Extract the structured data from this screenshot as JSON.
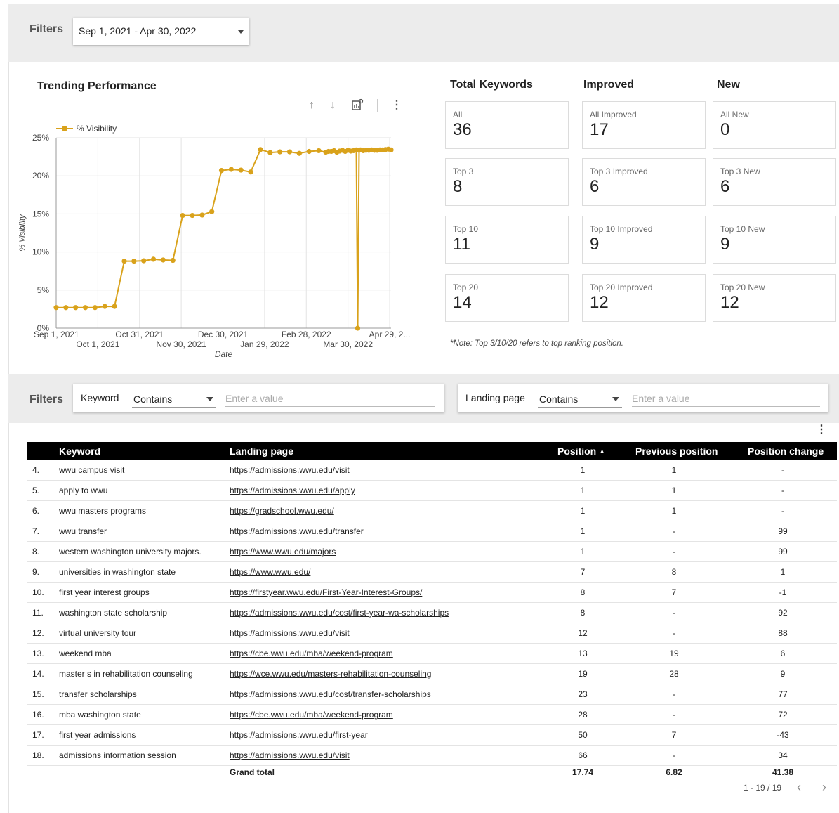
{
  "top_filter": {
    "label": "Filters",
    "date_range": "Sep 1, 2021 - Apr 30, 2022"
  },
  "chart": {
    "title": "Trending Performance",
    "icons": [
      "arrow-up-icon",
      "arrow-down-icon",
      "chart-options-icon",
      "more-vert-icon"
    ]
  },
  "chart_data": {
    "type": "line",
    "title": "Trending Performance",
    "xlabel": "Date",
    "ylabel": "% Visibility",
    "legend": "top-left",
    "series_name": "% Visibility",
    "color": "#d9a21b",
    "grid": true,
    "ylim": [
      0,
      25
    ],
    "xlim": [
      "2021-09-01",
      "2022-04-30"
    ],
    "y_ticks": [
      "0%",
      "5%",
      "10%",
      "15%",
      "20%",
      "25%"
    ],
    "x_ticks_upper": [
      "Sep 1, 2021",
      "Oct 31, 2021",
      "Dec 30, 2021",
      "Feb 28, 2022",
      "Apr 29, 2..."
    ],
    "x_ticks_lower": [
      "Oct 1, 2021",
      "Nov 30, 2021",
      "Jan 29, 2022",
      "Mar 30, 2022"
    ],
    "x": [
      "2021-09-01",
      "2021-09-08",
      "2021-09-15",
      "2021-09-22",
      "2021-09-29",
      "2021-10-06",
      "2021-10-13",
      "2021-10-20",
      "2021-10-27",
      "2021-11-03",
      "2021-11-10",
      "2021-11-17",
      "2021-11-24",
      "2021-12-01",
      "2021-12-08",
      "2021-12-15",
      "2021-12-22",
      "2021-12-29",
      "2022-01-05",
      "2022-01-12",
      "2022-01-19",
      "2022-01-26",
      "2022-02-02",
      "2022-02-09",
      "2022-02-16",
      "2022-02-23",
      "2022-03-02",
      "2022-03-09",
      "2022-03-14",
      "2022-03-16",
      "2022-03-18",
      "2022-03-20",
      "2022-03-22",
      "2022-03-24",
      "2022-03-26",
      "2022-03-28",
      "2022-03-30",
      "2022-04-01",
      "2022-04-03",
      "2022-04-05",
      "2022-04-06",
      "2022-04-07",
      "2022-04-08",
      "2022-04-10",
      "2022-04-12",
      "2022-04-14",
      "2022-04-16",
      "2022-04-18",
      "2022-04-20",
      "2022-04-22",
      "2022-04-24",
      "2022-04-26",
      "2022-04-28",
      "2022-04-30"
    ],
    "y": [
      2.7,
      2.7,
      2.7,
      2.7,
      2.7,
      2.85,
      2.85,
      8.8,
      8.8,
      8.85,
      9.05,
      8.95,
      8.9,
      14.8,
      14.8,
      14.85,
      15.3,
      20.7,
      20.85,
      20.75,
      20.5,
      23.45,
      23.05,
      23.15,
      23.15,
      22.95,
      23.2,
      23.3,
      23.1,
      23.2,
      23.2,
      23.3,
      23.1,
      23.25,
      23.35,
      23.2,
      23.35,
      23.25,
      23.3,
      23.4,
      0.0,
      23.35,
      23.4,
      23.3,
      23.35,
      23.35,
      23.4,
      23.35,
      23.35,
      23.4,
      23.4,
      23.45,
      23.5,
      23.4
    ]
  },
  "kpi": {
    "headers": [
      "Total Keywords",
      "Improved",
      "New"
    ],
    "columns": [
      [
        {
          "label": "All",
          "value": "36"
        },
        {
          "label": "Top 3",
          "value": "8"
        },
        {
          "label": "Top 10",
          "value": "11"
        },
        {
          "label": "Top 20",
          "value": "14"
        }
      ],
      [
        {
          "label": "All Improved",
          "value": "17"
        },
        {
          "label": "Top 3 Improved",
          "value": "6"
        },
        {
          "label": "Top 10 Improved",
          "value": "9"
        },
        {
          "label": "Top 20 Improved",
          "value": "12"
        }
      ],
      [
        {
          "label": "All New",
          "value": "0"
        },
        {
          "label": "Top 3 New",
          "value": "6"
        },
        {
          "label": "Top 10 New",
          "value": "9"
        },
        {
          "label": "Top 20 New",
          "value": "12"
        }
      ]
    ],
    "note": "*Note: Top 3/10/20 refers to top ranking position."
  },
  "filters2": {
    "label": "Filters",
    "keyword": {
      "name": "Keyword",
      "operator": "Contains",
      "placeholder": "Enter a value"
    },
    "landing": {
      "name": "Landing page",
      "operator": "Contains",
      "placeholder": "Enter a value"
    }
  },
  "table": {
    "columns": [
      "Keyword",
      "Landing page",
      "Position",
      "Previous position",
      "Position change"
    ],
    "sort_indicator": "▲",
    "rows": [
      {
        "n": "4.",
        "keyword": "wwu campus visit",
        "url": "https://admissions.wwu.edu/visit",
        "pos": "1",
        "prev": "1",
        "change": "-"
      },
      {
        "n": "5.",
        "keyword": "apply to wwu",
        "url": "https://admissions.wwu.edu/apply",
        "pos": "1",
        "prev": "1",
        "change": "-"
      },
      {
        "n": "6.",
        "keyword": "wwu masters programs",
        "url": "https://gradschool.wwu.edu/",
        "pos": "1",
        "prev": "1",
        "change": "-"
      },
      {
        "n": "7.",
        "keyword": "wwu transfer",
        "url": "https://admissions.wwu.edu/transfer",
        "pos": "1",
        "prev": "-",
        "change": "99"
      },
      {
        "n": "8.",
        "keyword": "western washington university majors.",
        "url": "https://www.wwu.edu/majors",
        "pos": "1",
        "prev": "-",
        "change": "99"
      },
      {
        "n": "9.",
        "keyword": "universities in washington state",
        "url": "https://www.wwu.edu/",
        "pos": "7",
        "prev": "8",
        "change": "1"
      },
      {
        "n": "10.",
        "keyword": "first year interest groups",
        "url": "https://firstyear.wwu.edu/First-Year-Interest-Groups/",
        "pos": "8",
        "prev": "7",
        "change": "-1"
      },
      {
        "n": "11.",
        "keyword": "washington state scholarship",
        "url": "https://admissions.wwu.edu/cost/first-year-wa-scholarships",
        "pos": "8",
        "prev": "-",
        "change": "92"
      },
      {
        "n": "12.",
        "keyword": "virtual university tour",
        "url": "https://admissions.wwu.edu/visit",
        "pos": "12",
        "prev": "-",
        "change": "88"
      },
      {
        "n": "13.",
        "keyword": "weekend mba",
        "url": "https://cbe.wwu.edu/mba/weekend-program",
        "pos": "13",
        "prev": "19",
        "change": "6"
      },
      {
        "n": "14.",
        "keyword": "master s in rehabilitation counseling",
        "url": "https://wce.wwu.edu/masters-rehabilitation-counseling",
        "pos": "19",
        "prev": "28",
        "change": "9"
      },
      {
        "n": "15.",
        "keyword": "transfer scholarships",
        "url": "https://admissions.wwu.edu/cost/transfer-scholarships",
        "pos": "23",
        "prev": "-",
        "change": "77"
      },
      {
        "n": "16.",
        "keyword": "mba washington state",
        "url": "https://cbe.wwu.edu/mba/weekend-program",
        "pos": "28",
        "prev": "-",
        "change": "72"
      },
      {
        "n": "17.",
        "keyword": "first year admissions",
        "url": "https://admissions.wwu.edu/first-year",
        "pos": "50",
        "prev": "7",
        "change": "-43"
      },
      {
        "n": "18.",
        "keyword": "admissions information session",
        "url": "https://admissions.wwu.edu/visit",
        "pos": "66",
        "prev": "-",
        "change": "34"
      }
    ],
    "total": {
      "label": "Grand total",
      "pos": "17.74",
      "prev": "6.82",
      "change": "41.38"
    }
  },
  "pagination": {
    "text": "1 - 19 / 19",
    "prev_icon": "chevron-left-icon",
    "next_icon": "chevron-right-icon"
  }
}
